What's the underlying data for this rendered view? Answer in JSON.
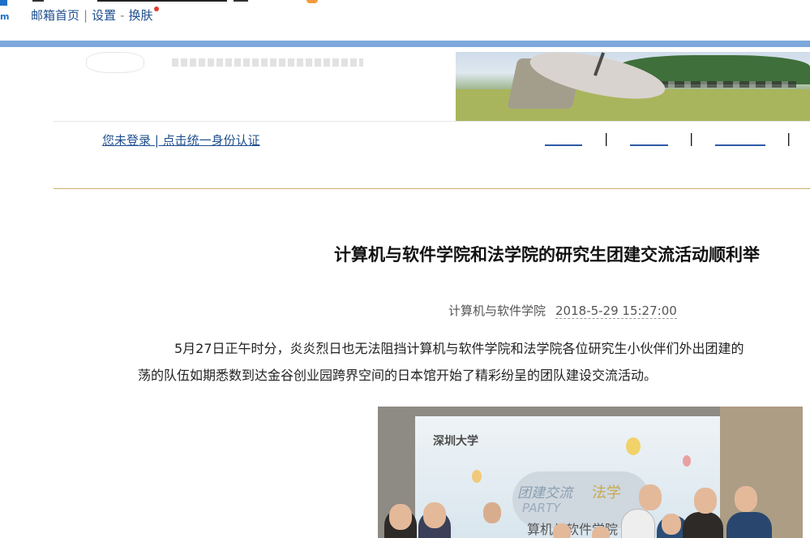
{
  "mail": {
    "links": [
      "邮箱首页",
      "设置",
      "换肤"
    ],
    "separators": [
      "|",
      "-"
    ]
  },
  "nav": {
    "login": "您未登录 | 点击统一身份认证",
    "separator": "|"
  },
  "article": {
    "title": "计算机与软件学院和法学院的研究生团建交流活动顺利举",
    "source": "计算机与软件学院",
    "date": "2018-5-29 15:27:00",
    "paragraph_line1": "5月27日正午时分，炎炎烈日也无法阻挡计算机与软件学院和法学院各位研究生小伙伴们外出团建的",
    "paragraph_line2": "荡的队伍如期悉数到达金谷创业园跨界空间的日本馆开始了精彩纷呈的团队建设交流活动。"
  },
  "photo": {
    "brand": "深圳大学",
    "line1": "团建交流",
    "line2": "PARTY",
    "law": "法学",
    "line3": "算机与软件学院"
  },
  "colors": {
    "link": "#1f4f8e",
    "blue_bar": "#7ea8dc",
    "gold_rule": "#c9b06e",
    "badge_dot": "#e03c2e"
  }
}
